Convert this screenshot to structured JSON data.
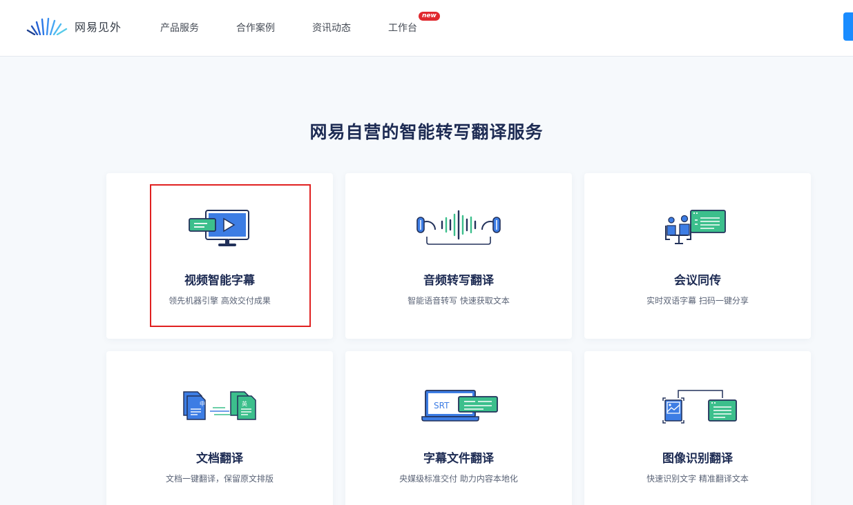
{
  "header": {
    "logo_text": "网易见外",
    "nav": [
      {
        "label": "产品服务"
      },
      {
        "label": "合作案例"
      },
      {
        "label": "资讯动态"
      },
      {
        "label": "工作台",
        "badge": "new"
      }
    ]
  },
  "section": {
    "title": "网易自营的智能转写翻译服务"
  },
  "cards": [
    {
      "title": "视频智能字幕",
      "desc": "领先机器引擎 高效交付成果",
      "icon": "video-subtitle-icon",
      "selected": true
    },
    {
      "title": "音频转写翻译",
      "desc": "智能语音转写 快速获取文本",
      "icon": "audio-transcribe-icon"
    },
    {
      "title": "会议同传",
      "desc": "实时双语字幕 扫码一键分享",
      "icon": "meeting-interpretation-icon"
    },
    {
      "title": "文档翻译",
      "desc": "文档一键翻译，保留原文排版",
      "icon": "document-translate-icon",
      "icon_labels": [
        "中",
        "英"
      ]
    },
    {
      "title": "字幕文件翻译",
      "desc": "央媒级标准交付 助力内容本地化",
      "icon": "subtitle-file-icon",
      "icon_labels": [
        "SRT"
      ]
    },
    {
      "title": "图像识别翻译",
      "desc": "快速识别文字 精准翻译文本",
      "icon": "image-ocr-icon"
    }
  ],
  "colors": {
    "primary_blue": "#3d7de4",
    "accent_green": "#3cbf8c",
    "dark_navy": "#1d2b53",
    "badge_red": "#e0292f",
    "selection_red": "#e02020"
  }
}
